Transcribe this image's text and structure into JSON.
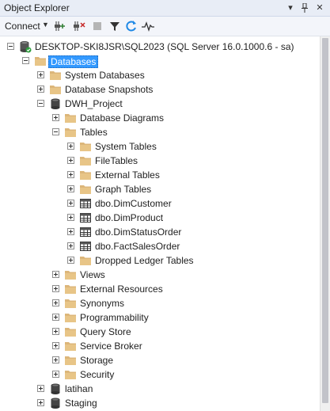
{
  "window": {
    "title": "Object Explorer",
    "pin_icon": "pin-icon",
    "close_icon": "close-icon",
    "menu_icon": "dropdown-icon"
  },
  "toolbar": {
    "connect_label": "Connect",
    "buttons": [
      "connect-add-icon",
      "disconnect-icon",
      "stop-icon",
      "filter-icon",
      "refresh-icon",
      "activity-monitor-icon"
    ]
  },
  "tree": [
    {
      "label": "DESKTOP-SKI8JSR\\SQL2023 (SQL Server 16.0.1000.6 - sa)",
      "level": 0,
      "expander": "minus",
      "icon": "server",
      "selected": false
    },
    {
      "label": "Databases",
      "level": 1,
      "expander": "minus",
      "icon": "folder",
      "selected": true
    },
    {
      "label": "System Databases",
      "level": 2,
      "expander": "plus",
      "icon": "folder",
      "selected": false
    },
    {
      "label": "Database Snapshots",
      "level": 2,
      "expander": "plus",
      "icon": "folder",
      "selected": false
    },
    {
      "label": "DWH_Project",
      "level": 2,
      "expander": "minus",
      "icon": "database",
      "selected": false
    },
    {
      "label": "Database Diagrams",
      "level": 3,
      "expander": "plus",
      "icon": "folder",
      "selected": false
    },
    {
      "label": "Tables",
      "level": 3,
      "expander": "minus",
      "icon": "folder",
      "selected": false
    },
    {
      "label": "System Tables",
      "level": 4,
      "expander": "plus",
      "icon": "folder",
      "selected": false
    },
    {
      "label": "FileTables",
      "level": 4,
      "expander": "plus",
      "icon": "folder",
      "selected": false
    },
    {
      "label": "External Tables",
      "level": 4,
      "expander": "plus",
      "icon": "folder",
      "selected": false
    },
    {
      "label": "Graph Tables",
      "level": 4,
      "expander": "plus",
      "icon": "folder",
      "selected": false
    },
    {
      "label": "dbo.DimCustomer",
      "level": 4,
      "expander": "plus",
      "icon": "table",
      "selected": false
    },
    {
      "label": "dbo.DimProduct",
      "level": 4,
      "expander": "plus",
      "icon": "table",
      "selected": false
    },
    {
      "label": "dbo.DimStatusOrder",
      "level": 4,
      "expander": "plus",
      "icon": "table",
      "selected": false
    },
    {
      "label": "dbo.FactSalesOrder",
      "level": 4,
      "expander": "plus",
      "icon": "table",
      "selected": false
    },
    {
      "label": "Dropped Ledger Tables",
      "level": 4,
      "expander": "plus",
      "icon": "folder",
      "selected": false
    },
    {
      "label": "Views",
      "level": 3,
      "expander": "plus",
      "icon": "folder",
      "selected": false
    },
    {
      "label": "External Resources",
      "level": 3,
      "expander": "plus",
      "icon": "folder",
      "selected": false
    },
    {
      "label": "Synonyms",
      "level": 3,
      "expander": "plus",
      "icon": "folder",
      "selected": false
    },
    {
      "label": "Programmability",
      "level": 3,
      "expander": "plus",
      "icon": "folder",
      "selected": false
    },
    {
      "label": "Query Store",
      "level": 3,
      "expander": "plus",
      "icon": "folder",
      "selected": false
    },
    {
      "label": "Service Broker",
      "level": 3,
      "expander": "plus",
      "icon": "folder",
      "selected": false
    },
    {
      "label": "Storage",
      "level": 3,
      "expander": "plus",
      "icon": "folder",
      "selected": false
    },
    {
      "label": "Security",
      "level": 3,
      "expander": "plus",
      "icon": "folder",
      "selected": false
    },
    {
      "label": "latihan",
      "level": 2,
      "expander": "plus",
      "icon": "database",
      "selected": false
    },
    {
      "label": "Staging",
      "level": 2,
      "expander": "plus",
      "icon": "database",
      "selected": false
    }
  ],
  "colors": {
    "selection": "#3399ff",
    "folder": "#dcb67a",
    "titlebar": "#e8edf6",
    "refresh": "#1e88e5"
  }
}
